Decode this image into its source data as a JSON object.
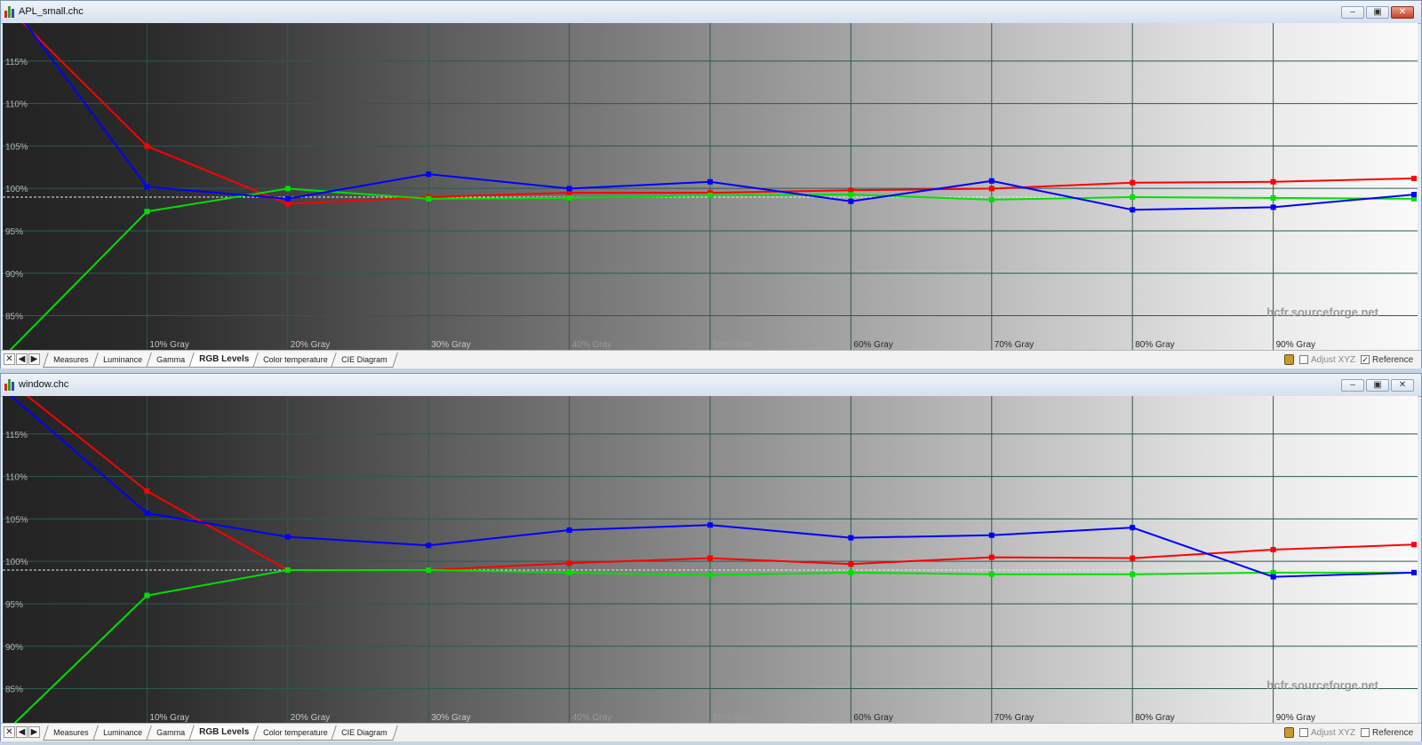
{
  "windows": [
    {
      "title": "APL_small.chc",
      "close_active": true,
      "tabs": [
        "Measures",
        "Luminance",
        "Gamma",
        "RGB Levels",
        "Color temperature",
        "CIE Diagram"
      ],
      "active_tab": "RGB Levels",
      "adjust_xyz_label": "Adjust XYZ",
      "adjust_xyz_checked": false,
      "reference_label": "Reference",
      "reference_checked": true,
      "watermark": "hcfr.sourceforge.net",
      "chart_data": {
        "type": "line",
        "x": [
          0,
          10,
          20,
          30,
          40,
          50,
          60,
          70,
          80,
          90,
          100
        ],
        "x_tick_labels": [
          "10% Gray",
          "20% Gray",
          "30% Gray",
          "40% Gray",
          "50% Gray",
          "60% Gray",
          "70% Gray",
          "80% Gray",
          "90% Gray"
        ],
        "y_tick_labels": [
          "115%",
          "110%",
          "105%",
          "100%",
          "95%",
          "90%",
          "85%"
        ],
        "ylim": [
          81.5,
          120
        ],
        "reference_line": 99.5,
        "grid": true,
        "series": [
          {
            "color": "#ff0000",
            "values": [
              122,
              105.5,
              98.7,
              99.5,
              100,
              100,
              100.3,
              100.5,
              101.2,
              101.3,
              101.7
            ]
          },
          {
            "color": "#00e000",
            "values": [
              81,
              97.8,
              100.5,
              99.3,
              99.4,
              99.7,
              99.8,
              99.2,
              99.5,
              99.4,
              99.3
            ]
          },
          {
            "color": "#0000ff",
            "values": [
              123,
              100.7,
              99.3,
              102.2,
              100.5,
              101.3,
              99,
              101.4,
              98,
              98.3,
              99.8
            ]
          }
        ]
      }
    },
    {
      "title": "window.chc",
      "close_active": false,
      "tabs": [
        "Measures",
        "Luminance",
        "Gamma",
        "RGB Levels",
        "Color temperature",
        "CIE Diagram"
      ],
      "active_tab": "RGB Levels",
      "adjust_xyz_label": "Adjust XYZ",
      "adjust_xyz_checked": false,
      "reference_label": "Reference",
      "reference_checked": false,
      "watermark": "hcfr.sourceforge.net",
      "chart_data": {
        "type": "line",
        "x": [
          0,
          10,
          20,
          30,
          40,
          50,
          60,
          70,
          80,
          90,
          100
        ],
        "x_tick_labels": [
          "10% Gray",
          "20% Gray",
          "30% Gray",
          "40% Gray",
          "50% Gray",
          "60% Gray",
          "70% Gray",
          "80% Gray",
          "90% Gray"
        ],
        "y_tick_labels": [
          "115%",
          "110%",
          "105%",
          "100%",
          "95%",
          "90%",
          "85%"
        ],
        "ylim": [
          81.5,
          120
        ],
        "reference_line": 99.5,
        "grid": true,
        "series": [
          {
            "color": "#ff0000",
            "values": [
              122,
              108.8,
              99.5,
              99.5,
              100.3,
              100.9,
              100.2,
              101,
              100.9,
              101.9,
              102.5
            ]
          },
          {
            "color": "#00e000",
            "values": [
              80.5,
              96.5,
              99.5,
              99.5,
              99.2,
              98.9,
              99.2,
              99,
              99,
              99.2,
              99.2
            ]
          },
          {
            "color": "#0000ff",
            "values": [
              120.5,
              106.2,
              103.4,
              102.4,
              104.2,
              104.8,
              103.3,
              103.6,
              104.5,
              98.7,
              99.2
            ]
          }
        ]
      }
    }
  ]
}
